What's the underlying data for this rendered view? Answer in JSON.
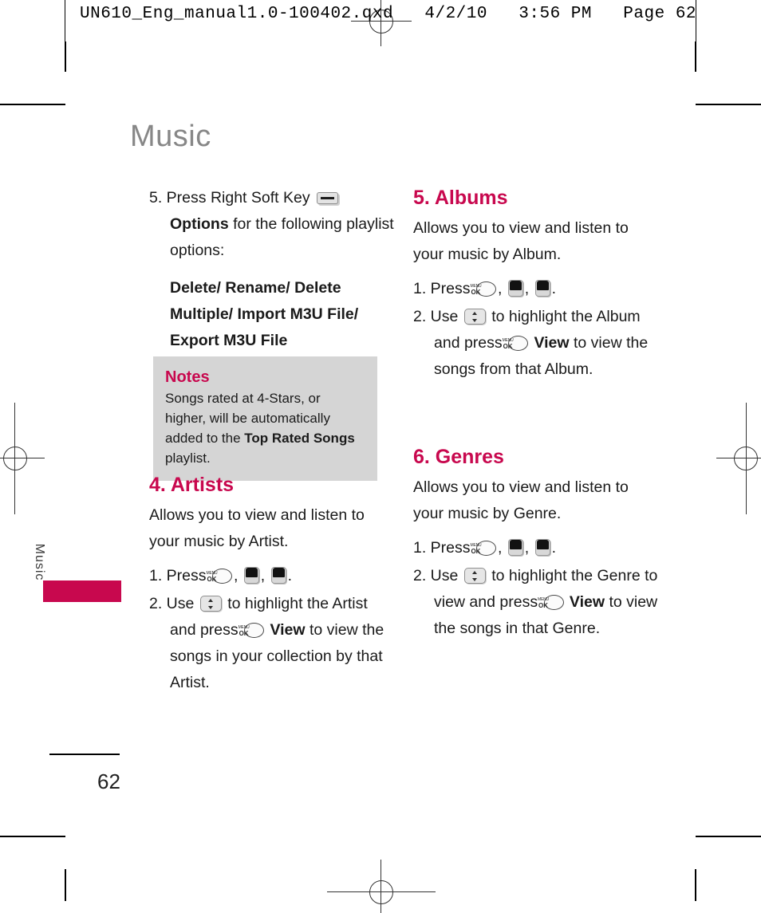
{
  "proof_header": {
    "text": "UN610_Eng_manual1.0-100402.qxd   4/2/10   3:56 PM   Page 62"
  },
  "colors": {
    "accent": "#c8084e",
    "title_gray": "#878787",
    "note_bg": "#d5d5d5"
  },
  "page": {
    "title": "Music",
    "side_tab_label": "Music",
    "number": "62"
  },
  "left_column": {
    "step5": {
      "prefix": "5. Press Right Soft Key",
      "soft_key_icon": "right-soft-key",
      "bold_word": "Options",
      "suffix": "for the following playlist options:"
    },
    "options_list": "Delete/ Rename/ Delete Multiple/ Import M3U File/ Export M3U File",
    "notes": {
      "title": "Notes",
      "body_part1": "Songs rated at 4-Stars, or higher, will be automatically added to the",
      "body_bold": "Top Rated Songs",
      "body_part2": "playlist."
    },
    "artists": {
      "heading": "4. Artists",
      "body": "Allows you to view and listen to your music by Artist.",
      "step1": {
        "prefix": "1. Press",
        "keys": [
          {
            "type": "menuok",
            "top": "MENU",
            "bottom": "OK"
          },
          {
            "type": "number",
            "digit": "7",
            "letter": "Z"
          },
          {
            "type": "number",
            "digit": "4",
            "letter": "S"
          }
        ],
        "suffix": "."
      },
      "step2": {
        "prefix": "2. Use",
        "nav_key_icon": "navigation-up-down-key",
        "mid1": "to highlight the Artist and press",
        "menuok_icon": "menu-ok-key",
        "bold_word": "View",
        "suffix": "to view the songs in your collection by that Artist."
      }
    }
  },
  "right_column": {
    "albums": {
      "heading": "5. Albums",
      "body": "Allows you to view and listen to your music by Album.",
      "step1": {
        "prefix": "1. Press",
        "keys": [
          {
            "type": "menuok",
            "top": "MENU",
            "bottom": "OK"
          },
          {
            "type": "number",
            "digit": "7",
            "letter": "Z"
          },
          {
            "type": "number",
            "digit": "5",
            "letter": "D"
          }
        ],
        "suffix": "."
      },
      "step2": {
        "prefix": "2. Use",
        "nav_key_icon": "navigation-up-down-key",
        "mid1": "to highlight the Album and press",
        "menuok_icon": "menu-ok-key",
        "bold_word": "View",
        "suffix": "to view the songs from that Album."
      }
    },
    "genres": {
      "heading": "6. Genres",
      "body": "Allows you to view and listen to your music by Genre.",
      "step1": {
        "prefix": "1. Press",
        "keys": [
          {
            "type": "menuok",
            "top": "MENU",
            "bottom": "OK"
          },
          {
            "type": "number",
            "digit": "7",
            "letter": "Z"
          },
          {
            "type": "number",
            "digit": "6",
            "letter": "F"
          }
        ],
        "suffix": "."
      },
      "step2": {
        "prefix": "2. Use",
        "nav_key_icon": "navigation-up-down-key",
        "mid1": "to highlight the Genre to view and press",
        "menuok_icon": "menu-ok-key",
        "bold_word": "View",
        "suffix": "to view the songs in that Genre."
      }
    }
  }
}
